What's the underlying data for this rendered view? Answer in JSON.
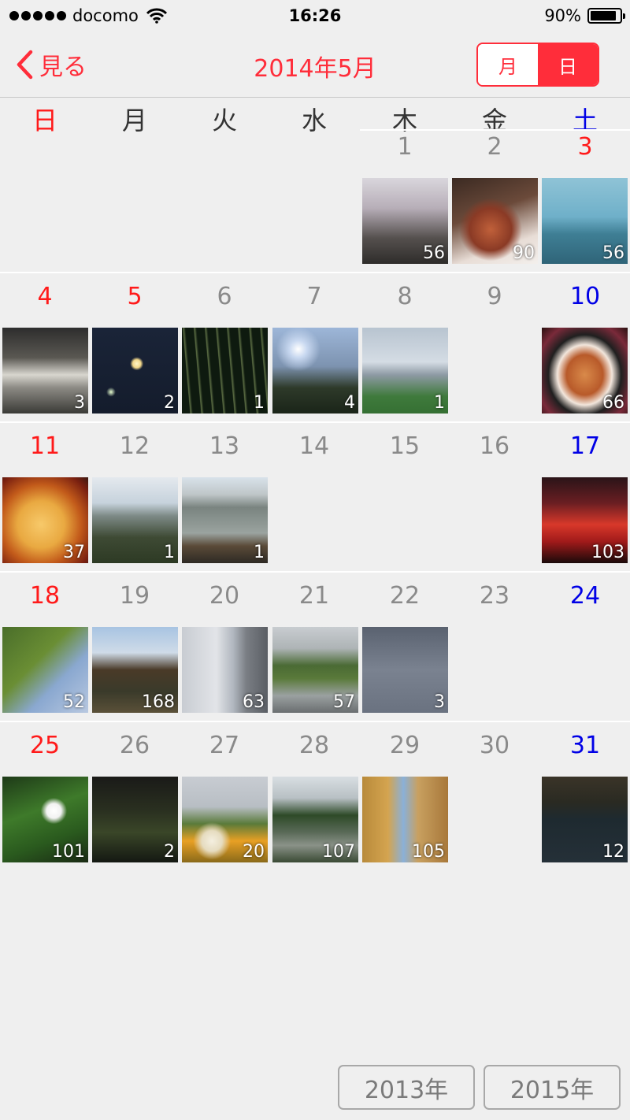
{
  "status_bar": {
    "carrier": "docomo",
    "time": "16:26",
    "battery": "90%",
    "battery_level": 0.9
  },
  "nav": {
    "back_label": "見る",
    "title": "2014年5月",
    "seg_month": "月",
    "seg_day": "日",
    "selected": "日"
  },
  "weekdays": [
    "日",
    "月",
    "火",
    "水",
    "木",
    "金",
    "土"
  ],
  "colors": {
    "accent": "#ff2d3a",
    "sunday": "#ff1a1a",
    "saturday": "#0000e6",
    "weekday_num": "#8a8a8a"
  },
  "weeks": [
    [
      null,
      null,
      null,
      null,
      {
        "day": "1",
        "count": "56",
        "thumb": "cherry-trees"
      },
      {
        "day": "2",
        "count": "90",
        "thumb": "tea-glass"
      },
      {
        "day": "3",
        "count": "56",
        "thumb": "sea"
      }
    ],
    [
      {
        "day": "4",
        "count": "3",
        "thumb": "stone-wall-water"
      },
      {
        "day": "5",
        "count": "2",
        "thumb": "moon-night"
      },
      {
        "day": "6",
        "count": "1",
        "thumb": "bamboo-night"
      },
      {
        "day": "7",
        "count": "4",
        "thumb": "tree-sky"
      },
      {
        "day": "8",
        "count": "1",
        "thumb": "bridge"
      },
      {
        "day": "9"
      },
      {
        "day": "10",
        "count": "66",
        "thumb": "cake"
      }
    ],
    [
      {
        "day": "11",
        "count": "37",
        "thumb": "oyakodon"
      },
      {
        "day": "12",
        "count": "1",
        "thumb": "city-view"
      },
      {
        "day": "13",
        "count": "1",
        "thumb": "roof-birds"
      },
      {
        "day": "14"
      },
      {
        "day": "15"
      },
      {
        "day": "16"
      },
      {
        "day": "17",
        "count": "103",
        "thumb": "red-sunset"
      }
    ],
    [
      {
        "day": "18",
        "count": "52",
        "thumb": "green-tree"
      },
      {
        "day": "19",
        "count": "168",
        "thumb": "temple"
      },
      {
        "day": "20",
        "count": "63",
        "thumb": "skytree"
      },
      {
        "day": "21",
        "count": "57",
        "thumb": "green-roof"
      },
      {
        "day": "22",
        "count": "3",
        "thumb": "rainbow"
      },
      {
        "day": "23"
      },
      {
        "day": "24"
      }
    ],
    [
      {
        "day": "25",
        "count": "101",
        "thumb": "white-flower"
      },
      {
        "day": "26",
        "count": "2",
        "thumb": "dark-bush"
      },
      {
        "day": "27",
        "count": "20",
        "thumb": "flower-field"
      },
      {
        "day": "28",
        "count": "107",
        "thumb": "fountain"
      },
      {
        "day": "29",
        "count": "105",
        "thumb": "ginkgo-avenue"
      },
      {
        "day": "30"
      },
      {
        "day": "31",
        "count": "12",
        "thumb": "pond-ducks"
      }
    ]
  ],
  "year_buttons": {
    "prev": "2013年",
    "next": "2015年"
  }
}
